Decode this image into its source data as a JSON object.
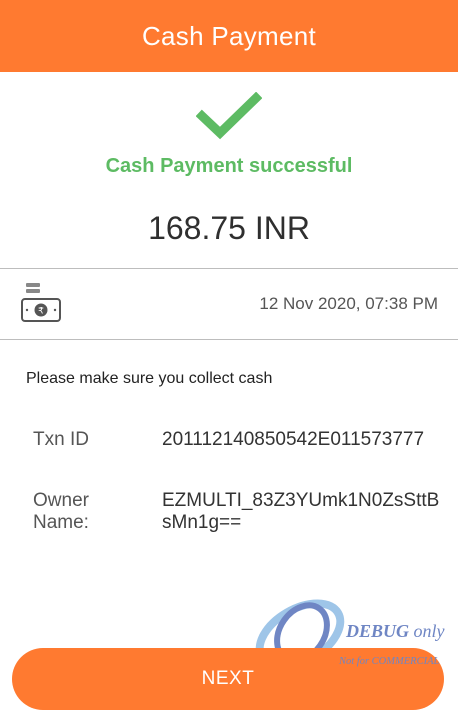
{
  "header": {
    "title": "Cash Payment"
  },
  "status": {
    "message": "Cash Payment successful",
    "icon": "check-icon"
  },
  "payment": {
    "amount": "168.75 INR",
    "datetime": "12 Nov 2020, 07:38 PM",
    "icon": "cash-icon"
  },
  "notice": "Please make sure you collect cash",
  "details": [
    {
      "label": "Txn ID",
      "value": "201112140850542E011573777"
    },
    {
      "label": "Owner Name:",
      "value": "EZMULTI_83Z3YUmk1N0ZsSttBsMn1g=="
    }
  ],
  "watermark": {
    "primary": "DEBUG",
    "secondary": "only",
    "note": "Not for COMMERCIAL"
  },
  "footer": {
    "next_label": "NEXT"
  },
  "colors": {
    "accent": "#ff7a30",
    "success": "#5dbb63"
  }
}
